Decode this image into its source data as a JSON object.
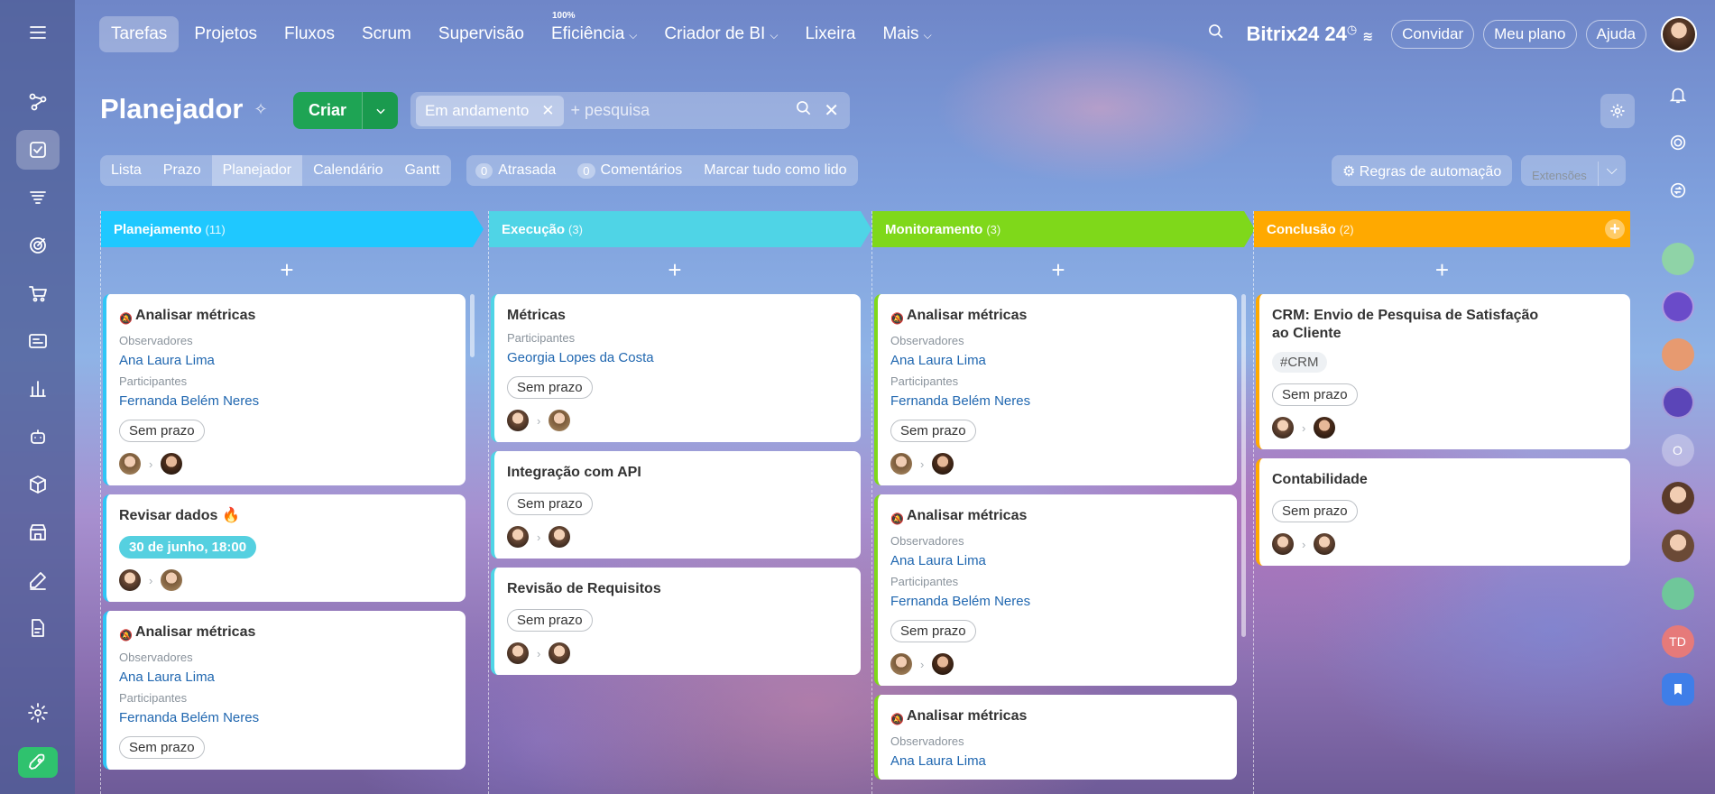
{
  "topnav": {
    "items": [
      {
        "label": "Tarefas"
      },
      {
        "label": "Projetos"
      },
      {
        "label": "Fluxos"
      },
      {
        "label": "Scrum"
      },
      {
        "label": "Supervisão"
      },
      {
        "label": "Eficiência",
        "sup": "100%"
      },
      {
        "label": "Criador de BI"
      },
      {
        "label": "Lixeira"
      },
      {
        "label": "Mais"
      }
    ],
    "brand": "Bitrix24",
    "brand_suffix": "24",
    "invite": "Convidar",
    "plan": "Meu plano",
    "help": "Ajuda"
  },
  "page": {
    "title": "Planejador",
    "create": "Criar",
    "filter_tag": "Em andamento",
    "search_placeholder": "+ pesquisa"
  },
  "view_tabs": [
    "Lista",
    "Prazo",
    "Planejador",
    "Calendário",
    "Gantt"
  ],
  "counters": {
    "overdue_num": "0",
    "overdue": "Atrasada",
    "comments_num": "0",
    "comments": "Comentários",
    "mark_read": "Marcar tudo como lido"
  },
  "toolbar": {
    "automation": "Regras de automação",
    "extensions": "Extensões"
  },
  "colors": {
    "planejamento": "#1fc8ff",
    "execucao": "#4fd4e6",
    "monitoramento": "#7fd81a",
    "conclusao": "#ffa900"
  },
  "columns": [
    {
      "name": "Planejamento",
      "count": "(11)",
      "cards": [
        {
          "title": "Analisar métricas",
          "muted": true,
          "obs_label": "Observadores",
          "obs": "Ana Laura Lima",
          "part_label": "Participantes",
          "part": "Fernanda Belém Neres",
          "deadline": "Sem prazo"
        },
        {
          "title": "Revisar dados",
          "fire": true,
          "date": "30 de junho, 18:00"
        },
        {
          "title": "Analisar métricas",
          "muted": true,
          "obs_label": "Observadores",
          "obs": "Ana Laura Lima",
          "part_label": "Participantes",
          "part": "Fernanda Belém Neres",
          "deadline": "Sem prazo"
        }
      ]
    },
    {
      "name": "Execução",
      "count": "(3)",
      "cards": [
        {
          "title": "Métricas",
          "part_label": "Participantes",
          "part": "Georgia Lopes da Costa",
          "deadline": "Sem prazo"
        },
        {
          "title": "Integração com API",
          "deadline": "Sem prazo"
        },
        {
          "title": "Revisão de Requisitos",
          "deadline": "Sem prazo"
        }
      ]
    },
    {
      "name": "Monitoramento",
      "count": "(3)",
      "cards": [
        {
          "title": "Analisar métricas",
          "muted": true,
          "obs_label": "Observadores",
          "obs": "Ana Laura Lima",
          "part_label": "Participantes",
          "part": "Fernanda Belém Neres",
          "deadline": "Sem prazo"
        },
        {
          "title": "Analisar métricas",
          "muted": true,
          "obs_label": "Observadores",
          "obs": "Ana Laura Lima",
          "part_label": "Participantes",
          "part": "Fernanda Belém Neres",
          "deadline": "Sem prazo"
        },
        {
          "title": "Analisar métricas",
          "muted": true,
          "obs_label": "Observadores",
          "obs": "Ana Laura Lima"
        }
      ]
    },
    {
      "name": "Conclusão",
      "count": "(2)",
      "cards": [
        {
          "title": "CRM: Envio de Pesquisa de Satisfação ao Cliente",
          "tag": "#CRM",
          "deadline": "Sem prazo"
        },
        {
          "title": "Contabilidade",
          "deadline": "Sem prazo"
        }
      ]
    }
  ],
  "right_rail": {
    "initials_o": "O",
    "initials_td": "TD"
  }
}
